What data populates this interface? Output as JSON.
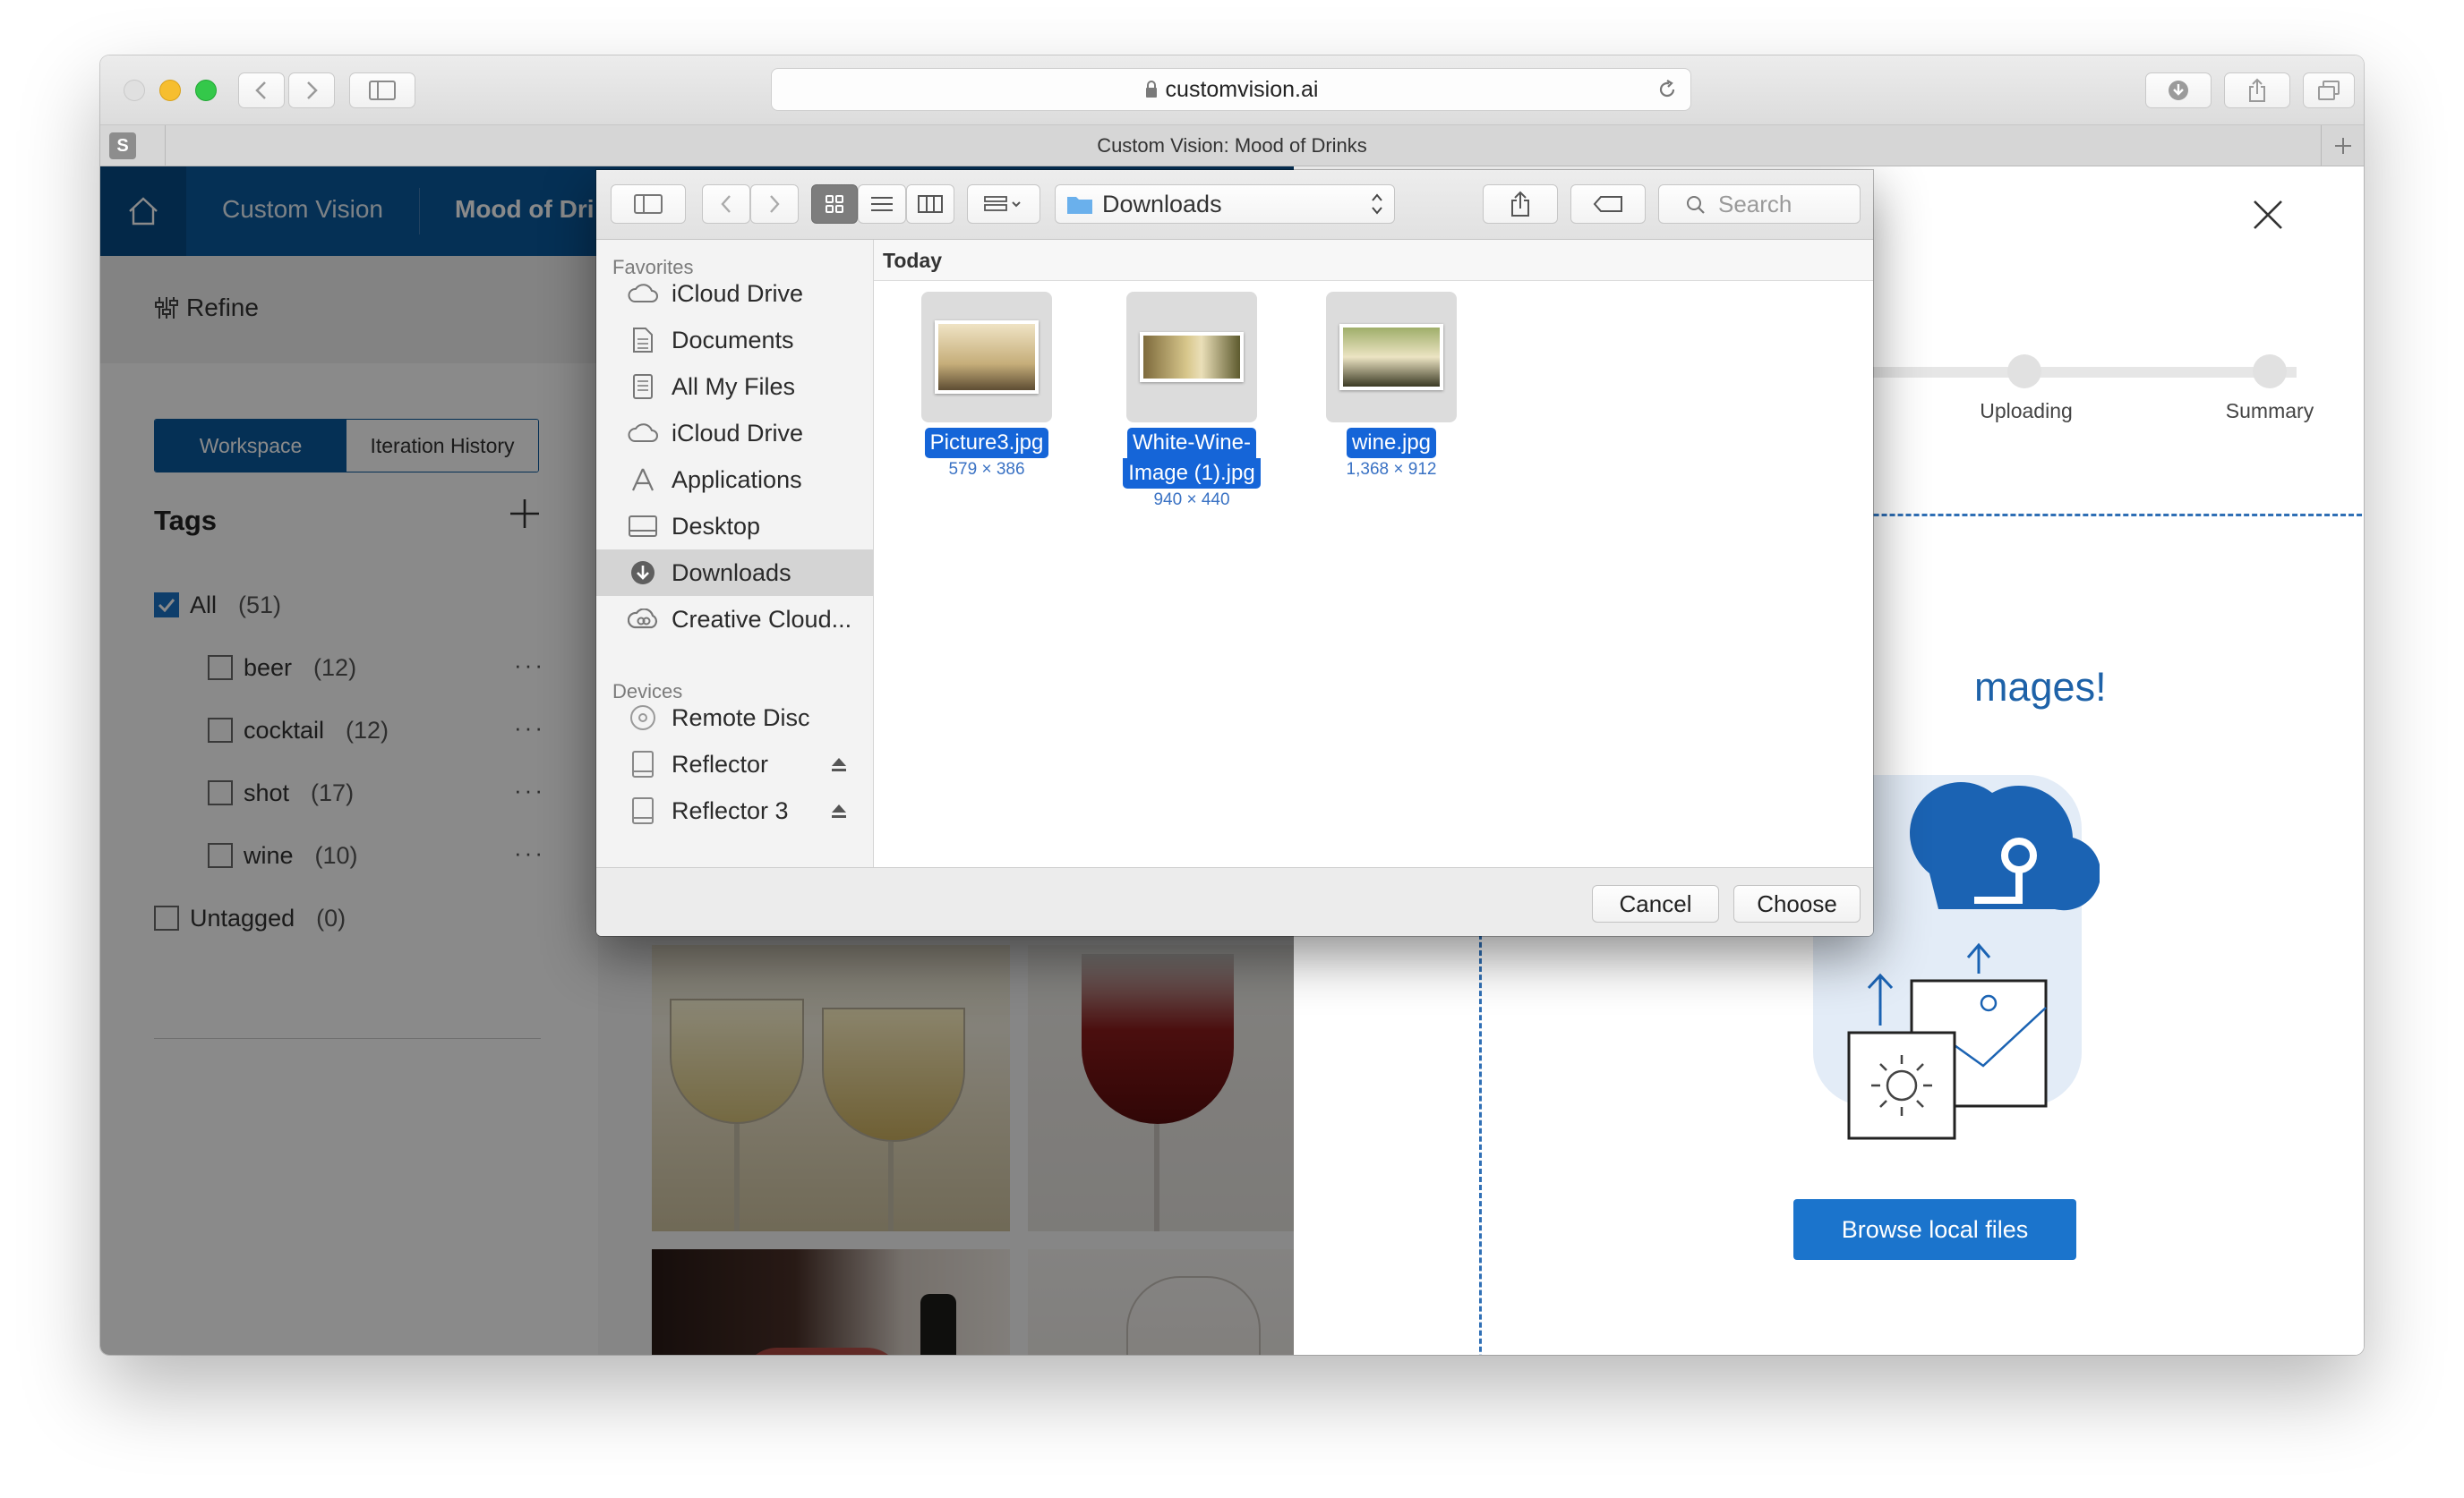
{
  "browser": {
    "url": "customvision.ai",
    "tab_title": "Custom Vision: Mood of Drinks",
    "sidebar_badge": "S"
  },
  "app": {
    "brand": "Custom Vision",
    "project": "Mood of Dri",
    "refine": "Refine",
    "segments": [
      "Workspace",
      "Iteration History"
    ],
    "tags_title": "Tags",
    "tags": [
      {
        "label": "All",
        "count": "(51)",
        "checked": true
      },
      {
        "label": "beer",
        "count": "(12)",
        "checked": false
      },
      {
        "label": "cocktail",
        "count": "(12)",
        "checked": false
      },
      {
        "label": "shot",
        "count": "(17)",
        "checked": false
      },
      {
        "label": "wine",
        "count": "(10)",
        "checked": false
      },
      {
        "label": "Untagged",
        "count": "(0)",
        "checked": false
      }
    ],
    "more": "···"
  },
  "upload_panel": {
    "steps": [
      "Uploading",
      "Summary"
    ],
    "heading_fragment": "mages!",
    "browse_button": "Browse local files"
  },
  "file_dialog": {
    "location": "Downloads",
    "search_placeholder": "Search",
    "favorites_header": "Favorites",
    "favorites": [
      "iCloud Drive",
      "Documents",
      "All My Files",
      "iCloud Drive",
      "Applications",
      "Desktop",
      "Downloads",
      "Creative Cloud..."
    ],
    "devices_header": "Devices",
    "devices": [
      "Remote Disc",
      "Reflector",
      "Reflector 3"
    ],
    "section": "Today",
    "files": [
      {
        "name_lines": [
          "Picture3.jpg"
        ],
        "dims": "579 × 386"
      },
      {
        "name_lines": [
          "White-Wine-",
          "Image (1).jpg"
        ],
        "dims": "940 × 440"
      },
      {
        "name_lines": [
          "wine.jpg"
        ],
        "dims": "1,368 × 912"
      }
    ],
    "cancel": "Cancel",
    "choose": "Choose"
  },
  "colors": {
    "nav": "#0b5a9e",
    "accent": "#1a73c6",
    "selection": "#1565d8",
    "dashed": "#2f6fb5"
  }
}
